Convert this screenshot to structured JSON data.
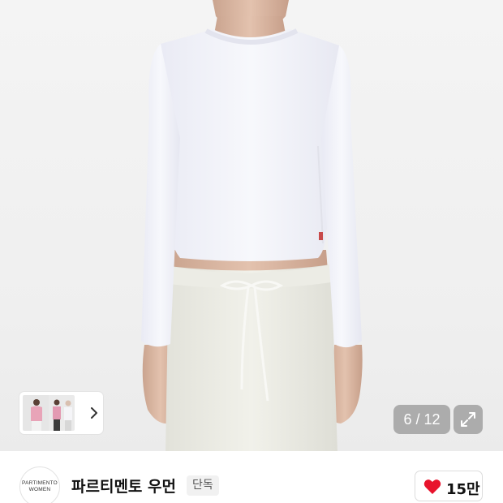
{
  "gallery": {
    "counter": "6 / 12",
    "expand_icon": "expand-icon",
    "thumbnail_next_icon": "chevron-right-icon"
  },
  "brand": {
    "logo_line1": "PARTIMENTO",
    "logo_line2": "WOMEN",
    "name": "파르티멘토 우먼",
    "badge": "단독"
  },
  "like": {
    "icon": "heart-icon",
    "count": "15만",
    "color": "#e8132c"
  }
}
